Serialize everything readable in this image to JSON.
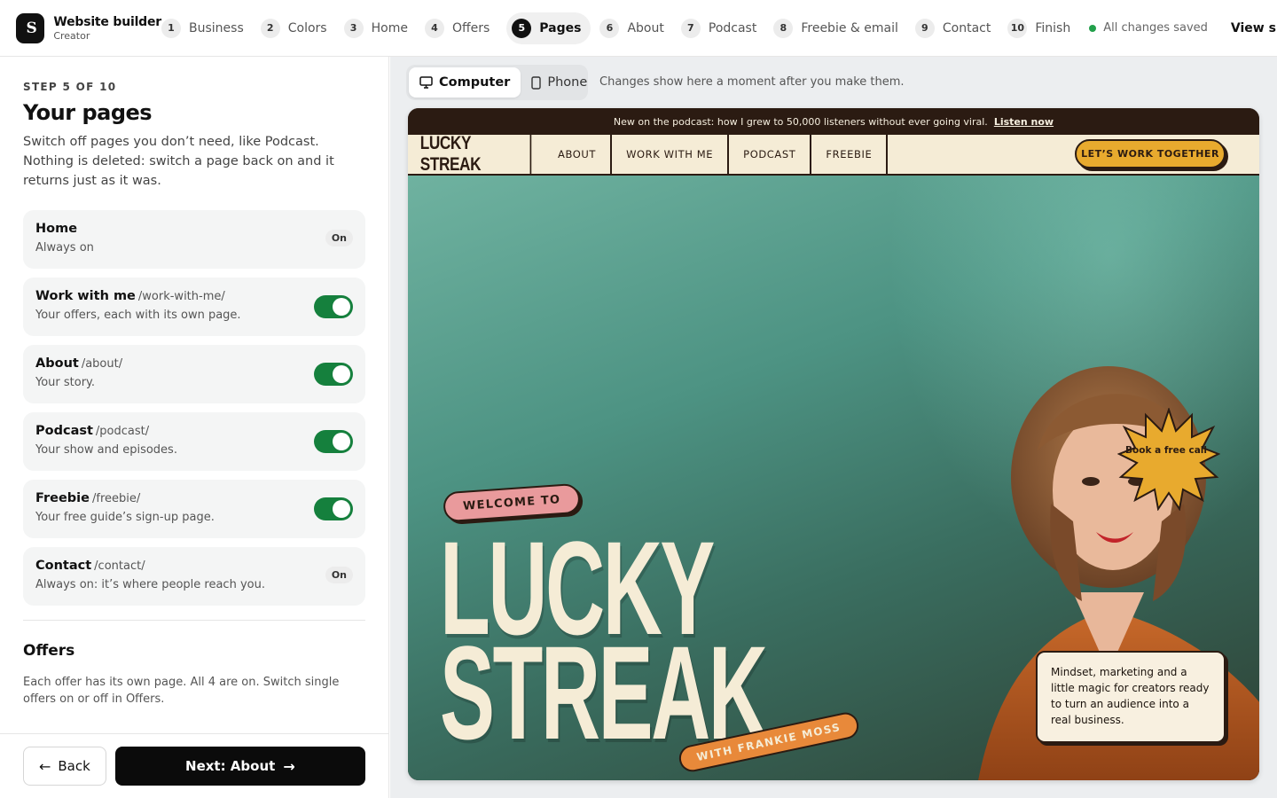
{
  "app": {
    "name": "Website builder",
    "plan": "Creator",
    "logo_text": "S"
  },
  "steps": [
    {
      "num": "1",
      "label": "Business"
    },
    {
      "num": "2",
      "label": "Colors"
    },
    {
      "num": "3",
      "label": "Home"
    },
    {
      "num": "4",
      "label": "Offers"
    },
    {
      "num": "5",
      "label": "Pages"
    },
    {
      "num": "6",
      "label": "About"
    },
    {
      "num": "7",
      "label": "Podcast"
    },
    {
      "num": "8",
      "label": "Freebie & email"
    },
    {
      "num": "9",
      "label": "Contact"
    },
    {
      "num": "10",
      "label": "Finish"
    }
  ],
  "active_step": 5,
  "status": {
    "saved": "All changes saved",
    "color": "#22a04b"
  },
  "view_site": "View site",
  "panel": {
    "eyebrow": "STEP 5 OF 10",
    "title": "Your pages",
    "description": "Switch off pages you don’t need, like Podcast. Nothing is deleted: switch a page back on and it returns just as it was.",
    "pages": [
      {
        "title": "Home",
        "slug": "",
        "sub": "Always on",
        "state": "On",
        "locked": true
      },
      {
        "title": "Work with me",
        "slug": "/work-with-me/",
        "sub": "Your offers, each with its own page.",
        "locked": false,
        "enabled": true
      },
      {
        "title": "About",
        "slug": "/about/",
        "sub": "Your story.",
        "locked": false,
        "enabled": true
      },
      {
        "title": "Podcast",
        "slug": "/podcast/",
        "sub": "Your show and episodes.",
        "locked": false,
        "enabled": true
      },
      {
        "title": "Freebie",
        "slug": "/freebie/",
        "sub": "Your free guide’s sign-up page.",
        "locked": false,
        "enabled": true
      },
      {
        "title": "Contact",
        "slug": "/contact/",
        "sub": "Always on: it’s where people reach you.",
        "state": "On",
        "locked": true
      }
    ],
    "offers_title": "Offers",
    "offers_desc": "Each offer has its own page. All 4 are on. Switch single offers on or off in Offers.",
    "back": "Back",
    "next": "Next: About"
  },
  "preview": {
    "devices": [
      "Computer",
      "Phone"
    ],
    "active_device": "Computer",
    "hint": "Changes show here a moment after you make them.",
    "site": {
      "announcement": "New on the podcast: how I grew to 50,000 listeners without ever going viral.",
      "announcement_link": "Listen now",
      "logo": "LUCKY STREAK",
      "nav": [
        "ABOUT",
        "WORK WITH ME",
        "PODCAST",
        "FREEBIE"
      ],
      "cta": "LET’S WORK TOGETHER",
      "welcome": "WELCOME TO",
      "headline_1": "LUCKY",
      "headline_2": "STREAK",
      "byline": "WITH FRANKIE MOSS",
      "badge": "Book a free call",
      "note": "Mindset, marketing and a little magic for creators ready to turn an audience into a real business.",
      "colors": {
        "dark": "#2b1b12",
        "cream": "#f5ecd6",
        "yellow": "#e8aa2e",
        "pink": "#e99a9c",
        "orange": "#e8893a",
        "teal": "#4d9383"
      }
    }
  }
}
